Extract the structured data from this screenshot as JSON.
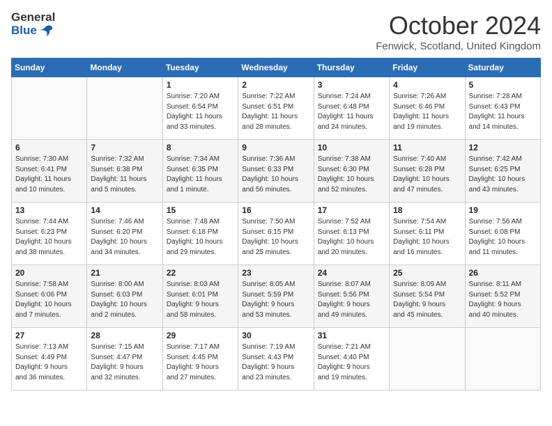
{
  "header": {
    "logo_general": "General",
    "logo_blue": "Blue",
    "month_title": "October 2024",
    "location": "Fenwick, Scotland, United Kingdom"
  },
  "weekdays": [
    "Sunday",
    "Monday",
    "Tuesday",
    "Wednesday",
    "Thursday",
    "Friday",
    "Saturday"
  ],
  "weeks": [
    [
      {
        "day": "",
        "info": ""
      },
      {
        "day": "",
        "info": ""
      },
      {
        "day": "1",
        "info": "Sunrise: 7:20 AM\nSunset: 6:54 PM\nDaylight: 11 hours\nand 33 minutes."
      },
      {
        "day": "2",
        "info": "Sunrise: 7:22 AM\nSunset: 6:51 PM\nDaylight: 11 hours\nand 28 minutes."
      },
      {
        "day": "3",
        "info": "Sunrise: 7:24 AM\nSunset: 6:48 PM\nDaylight: 11 hours\nand 24 minutes."
      },
      {
        "day": "4",
        "info": "Sunrise: 7:26 AM\nSunset: 6:46 PM\nDaylight: 11 hours\nand 19 minutes."
      },
      {
        "day": "5",
        "info": "Sunrise: 7:28 AM\nSunset: 6:43 PM\nDaylight: 11 hours\nand 14 minutes."
      }
    ],
    [
      {
        "day": "6",
        "info": "Sunrise: 7:30 AM\nSunset: 6:41 PM\nDaylight: 11 hours\nand 10 minutes."
      },
      {
        "day": "7",
        "info": "Sunrise: 7:32 AM\nSunset: 6:38 PM\nDaylight: 11 hours\nand 5 minutes."
      },
      {
        "day": "8",
        "info": "Sunrise: 7:34 AM\nSunset: 6:35 PM\nDaylight: 11 hours\nand 1 minute."
      },
      {
        "day": "9",
        "info": "Sunrise: 7:36 AM\nSunset: 6:33 PM\nDaylight: 10 hours\nand 56 minutes."
      },
      {
        "day": "10",
        "info": "Sunrise: 7:38 AM\nSunset: 6:30 PM\nDaylight: 10 hours\nand 52 minutes."
      },
      {
        "day": "11",
        "info": "Sunrise: 7:40 AM\nSunset: 6:28 PM\nDaylight: 10 hours\nand 47 minutes."
      },
      {
        "day": "12",
        "info": "Sunrise: 7:42 AM\nSunset: 6:25 PM\nDaylight: 10 hours\nand 43 minutes."
      }
    ],
    [
      {
        "day": "13",
        "info": "Sunrise: 7:44 AM\nSunset: 6:23 PM\nDaylight: 10 hours\nand 38 minutes."
      },
      {
        "day": "14",
        "info": "Sunrise: 7:46 AM\nSunset: 6:20 PM\nDaylight: 10 hours\nand 34 minutes."
      },
      {
        "day": "15",
        "info": "Sunrise: 7:48 AM\nSunset: 6:18 PM\nDaylight: 10 hours\nand 29 minutes."
      },
      {
        "day": "16",
        "info": "Sunrise: 7:50 AM\nSunset: 6:15 PM\nDaylight: 10 hours\nand 25 minutes."
      },
      {
        "day": "17",
        "info": "Sunrise: 7:52 AM\nSunset: 6:13 PM\nDaylight: 10 hours\nand 20 minutes."
      },
      {
        "day": "18",
        "info": "Sunrise: 7:54 AM\nSunset: 6:11 PM\nDaylight: 10 hours\nand 16 minutes."
      },
      {
        "day": "19",
        "info": "Sunrise: 7:56 AM\nSunset: 6:08 PM\nDaylight: 10 hours\nand 11 minutes."
      }
    ],
    [
      {
        "day": "20",
        "info": "Sunrise: 7:58 AM\nSunset: 6:06 PM\nDaylight: 10 hours\nand 7 minutes."
      },
      {
        "day": "21",
        "info": "Sunrise: 8:00 AM\nSunset: 6:03 PM\nDaylight: 10 hours\nand 2 minutes."
      },
      {
        "day": "22",
        "info": "Sunrise: 8:03 AM\nSunset: 6:01 PM\nDaylight: 9 hours\nand 58 minutes."
      },
      {
        "day": "23",
        "info": "Sunrise: 8:05 AM\nSunset: 5:59 PM\nDaylight: 9 hours\nand 53 minutes."
      },
      {
        "day": "24",
        "info": "Sunrise: 8:07 AM\nSunset: 5:56 PM\nDaylight: 9 hours\nand 49 minutes."
      },
      {
        "day": "25",
        "info": "Sunrise: 8:09 AM\nSunset: 5:54 PM\nDaylight: 9 hours\nand 45 minutes."
      },
      {
        "day": "26",
        "info": "Sunrise: 8:11 AM\nSunset: 5:52 PM\nDaylight: 9 hours\nand 40 minutes."
      }
    ],
    [
      {
        "day": "27",
        "info": "Sunrise: 7:13 AM\nSunset: 4:49 PM\nDaylight: 9 hours\nand 36 minutes."
      },
      {
        "day": "28",
        "info": "Sunrise: 7:15 AM\nSunset: 4:47 PM\nDaylight: 9 hours\nand 32 minutes."
      },
      {
        "day": "29",
        "info": "Sunrise: 7:17 AM\nSunset: 4:45 PM\nDaylight: 9 hours\nand 27 minutes."
      },
      {
        "day": "30",
        "info": "Sunrise: 7:19 AM\nSunset: 4:43 PM\nDaylight: 9 hours\nand 23 minutes."
      },
      {
        "day": "31",
        "info": "Sunrise: 7:21 AM\nSunset: 4:40 PM\nDaylight: 9 hours\nand 19 minutes."
      },
      {
        "day": "",
        "info": ""
      },
      {
        "day": "",
        "info": ""
      }
    ]
  ]
}
